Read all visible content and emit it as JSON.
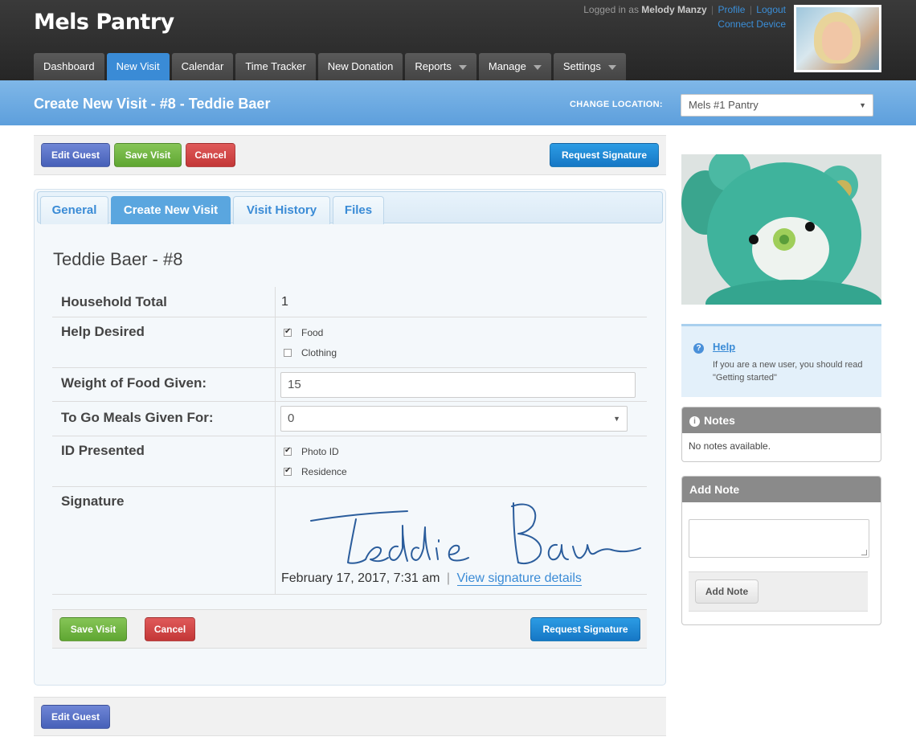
{
  "app": {
    "brand": "Mels Pantry",
    "logged_in_prefix": "Logged in as",
    "user_name": "Melody Manzy",
    "profile_link": "Profile",
    "separator": "|",
    "logout_link": "Logout",
    "connect_device": "Connect Device"
  },
  "nav": [
    {
      "label": "Dashboard"
    },
    {
      "label": "New Visit"
    },
    {
      "label": "Calendar"
    },
    {
      "label": "Time Tracker"
    },
    {
      "label": "New Donation"
    },
    {
      "label": "Reports"
    },
    {
      "label": "Manage"
    },
    {
      "label": "Settings"
    }
  ],
  "page": {
    "title": "Create New Visit - #8 - Teddie Baer",
    "change_location_label": "CHANGE LOCATION:",
    "location_value": "Mels #1 Pantry"
  },
  "toolbar": {
    "edit_guest": "Edit Guest",
    "save_visit": "Save Visit",
    "cancel": "Cancel",
    "request_signature": "Request Signature"
  },
  "tabs": [
    {
      "label": "General"
    },
    {
      "label": "Create New Visit"
    },
    {
      "label": "Visit History"
    },
    {
      "label": "Files"
    }
  ],
  "guest": {
    "heading": "Teddie Baer - #8"
  },
  "form": {
    "household_total_label": "Household Total",
    "household_total_value": "1",
    "help_desired_label": "Help Desired",
    "help_options": [
      {
        "label": "Food",
        "checked": true
      },
      {
        "label": "Clothing",
        "checked": false
      }
    ],
    "weight_label": "Weight of Food Given:",
    "weight_value": "15",
    "togo_label": "To Go Meals Given For:",
    "togo_value": "0",
    "id_label": "ID Presented",
    "id_options": [
      {
        "label": "Photo ID",
        "checked": true
      },
      {
        "label": "Residence",
        "checked": true
      }
    ],
    "signature_label": "Signature",
    "signature_date": "February 17, 2017, 7:31 am",
    "signature_sep": "|",
    "signature_link": "View signature details"
  },
  "bottom": {
    "save_visit": "Save Visit",
    "cancel": "Cancel",
    "request_signature": "Request Signature"
  },
  "footer": {
    "edit_guest": "Edit Guest"
  },
  "sidebar": {
    "help_title": "Help",
    "help_text": "If you are a new user, you should read \"Getting started\"",
    "notes_title": "Notes",
    "notes_empty": "No notes available.",
    "add_note_title": "Add Note",
    "add_note_button": "Add Note"
  },
  "colors": {
    "accent": "#3a8bd6",
    "header_bg": "#2e2e2e",
    "page_header": "#6aa9e2",
    "green_button": "#6cb33f",
    "red_button": "#d04646"
  }
}
